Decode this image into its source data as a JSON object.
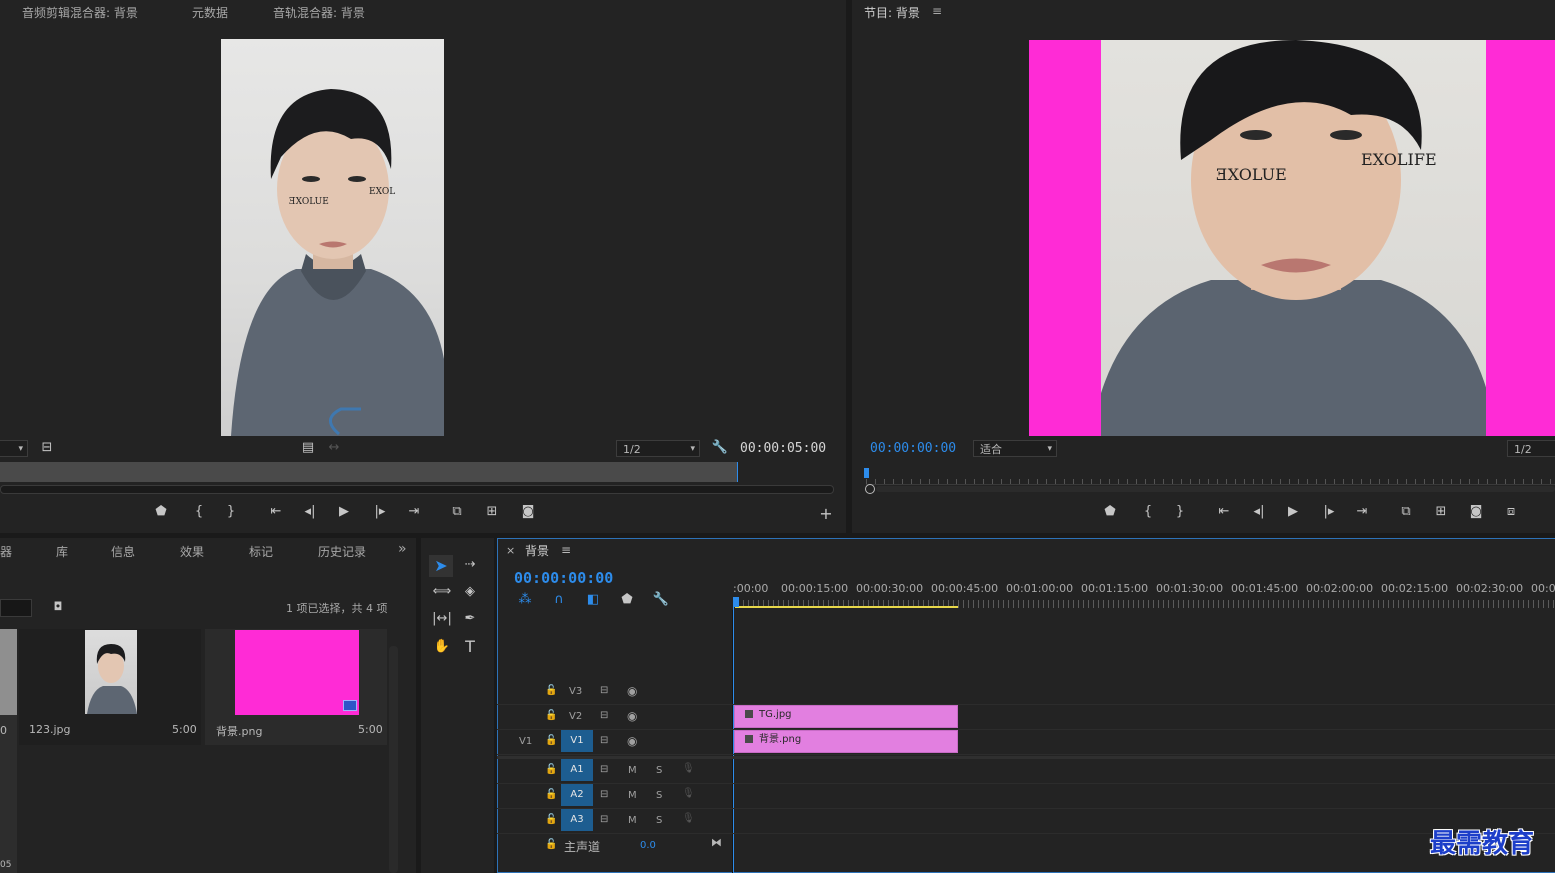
{
  "source_monitor": {
    "tabs": [
      "音频剪辑混合器: 背景",
      "元数据",
      "音轨混合器: 背景"
    ],
    "zoom": "1/2",
    "timecode": "00:00:05:00"
  },
  "program_monitor": {
    "title": "节目: 背景",
    "menu_glyph": "≡",
    "timecode": "00:00:00:00",
    "fit": "适合",
    "zoom": "1/2"
  },
  "project_panel": {
    "tabs": [
      "器",
      "库",
      "信息",
      "效果",
      "标记",
      "历史记录"
    ],
    "overflow": "»",
    "selection_status": "1 项已选择，共 4 项",
    "items": [
      {
        "name": "123.jpg",
        "duration": "5:00"
      },
      {
        "name": "背景.png",
        "duration": "5:00"
      }
    ],
    "left_edge_text": "0",
    "bottom_edge_text": "05"
  },
  "timeline": {
    "close": "×",
    "sequence": "背景",
    "menu_glyph": "≡",
    "timecode": "00:00:00:00",
    "ruler_labels": [
      ":00:00",
      "00:00:15:00",
      "00:00:30:00",
      "00:00:45:00",
      "00:01:00:00",
      "00:01:15:00",
      "00:01:30:00",
      "00:01:45:00",
      "00:02:00:00",
      "00:02:15:00",
      "00:02:30:00",
      "00:02"
    ],
    "video_tracks": [
      {
        "label": "V3",
        "source": ""
      },
      {
        "label": "V2",
        "source": ""
      },
      {
        "label": "V1",
        "source": "V1"
      }
    ],
    "audio_tracks": [
      {
        "label": "A1",
        "m": "M",
        "s": "S"
      },
      {
        "label": "A2",
        "m": "M",
        "s": "S"
      },
      {
        "label": "A3",
        "m": "M",
        "s": "S"
      }
    ],
    "master": {
      "label": "主声道",
      "value": "0.0"
    },
    "clips": [
      {
        "name": "TG.jpg",
        "track": "V2"
      },
      {
        "name": "背景.png",
        "track": "V1"
      }
    ]
  },
  "watermark": "最需教育",
  "colors": {
    "accent_blue": "#2d8ceb",
    "magenta": "#ff2bd6",
    "clip_pink": "#e27fe0",
    "track_toggle": "#1d5d90"
  }
}
